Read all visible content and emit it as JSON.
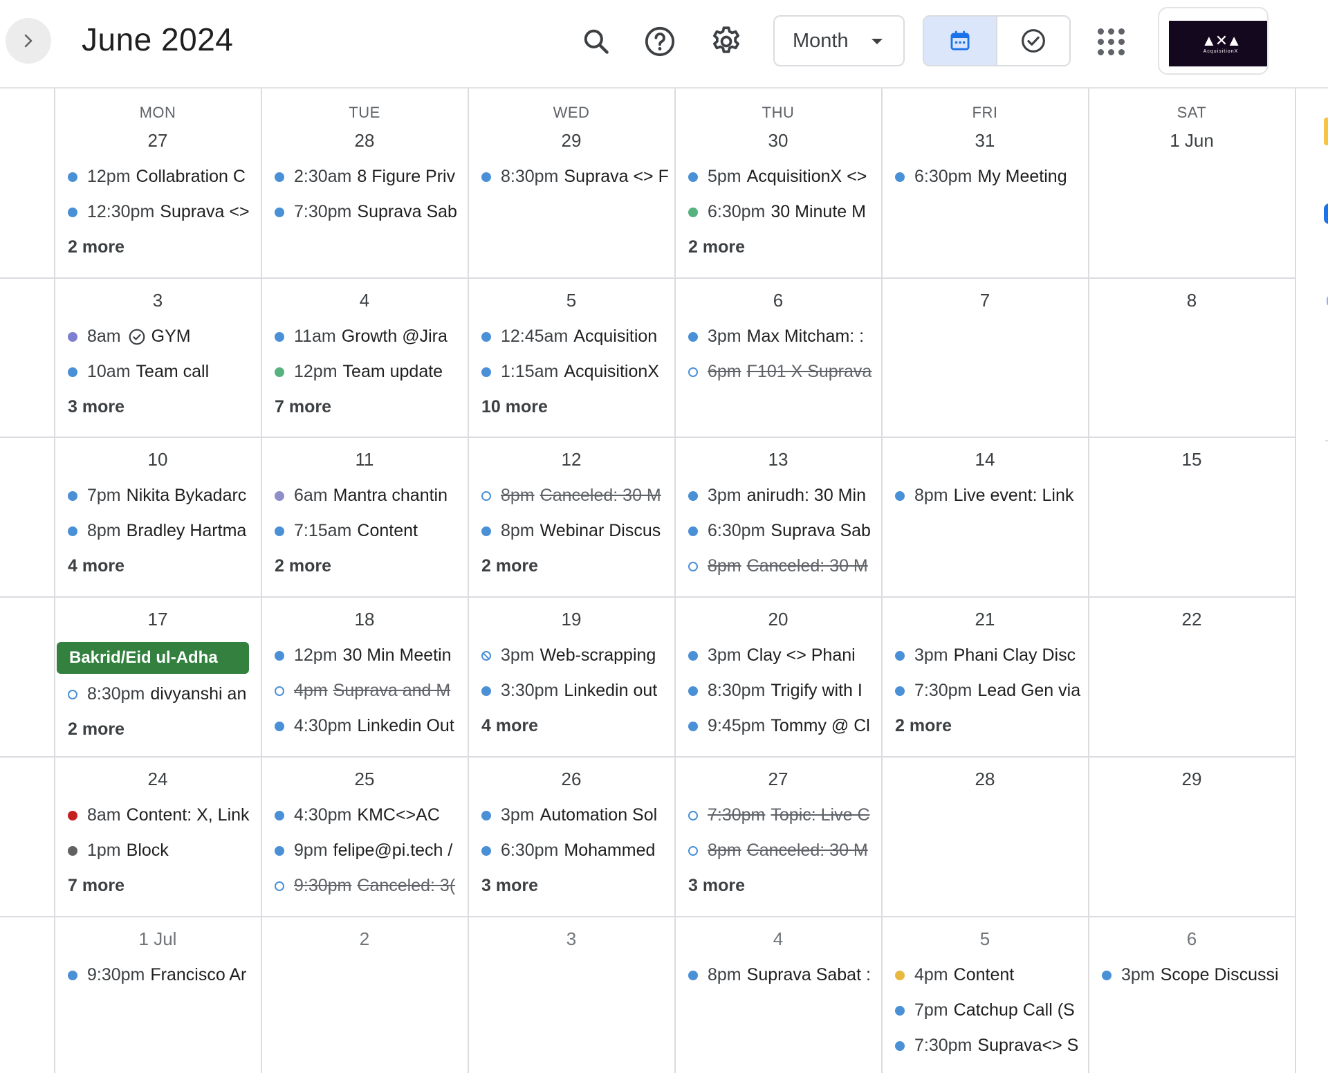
{
  "header": {
    "title": "June 2024",
    "view": "Month",
    "icons": [
      "chevron-right-icon",
      "search-icon",
      "help-icon",
      "settings-icon",
      "calendar-icon",
      "tasks-check-icon",
      "apps-grid-icon"
    ],
    "account_logo_text": "AcquisitionX"
  },
  "colors": {
    "blue": "#4a90d6",
    "green": "#57b27f",
    "purple": "#7f7fd1",
    "lavender": "#8e8ec8",
    "red": "#c5221f",
    "gray": "#616161",
    "yellow": "#e8b93f",
    "holiday": "#33803f",
    "active_view": "#dbe6fb"
  },
  "weekdays": [
    "MON",
    "TUE",
    "WED",
    "THU",
    "FRI",
    "SAT"
  ],
  "weeks": [
    [
      {
        "day": "27",
        "events": [
          {
            "time": "12pm",
            "name": "Collabration C",
            "color": "blue"
          },
          {
            "time": "12:30pm",
            "name": "Suprava <>",
            "color": "blue"
          }
        ],
        "more": "2 more"
      },
      {
        "day": "28",
        "events": [
          {
            "time": "2:30am",
            "name": "8 Figure Priv",
            "color": "blue"
          },
          {
            "time": "7:30pm",
            "name": "Suprava Sab",
            "color": "blue"
          }
        ]
      },
      {
        "day": "29",
        "events": [
          {
            "time": "8:30pm",
            "name": "Suprava <> F",
            "color": "blue"
          }
        ]
      },
      {
        "day": "30",
        "events": [
          {
            "time": "5pm",
            "name": "AcquisitionX <>",
            "color": "blue"
          },
          {
            "time": "6:30pm",
            "name": "30 Minute M",
            "color": "green"
          }
        ],
        "more": "2 more"
      },
      {
        "day": "31",
        "events": [
          {
            "time": "6:30pm",
            "name": "My Meeting",
            "color": "blue"
          }
        ]
      },
      {
        "day": "1 Jun",
        "events": []
      }
    ],
    [
      {
        "day": "3",
        "events": [
          {
            "time": "8am",
            "name": "GYM",
            "color": "purple",
            "task": true
          },
          {
            "time": "10am",
            "name": "Team call",
            "color": "blue"
          }
        ],
        "more": "3 more"
      },
      {
        "day": "4",
        "events": [
          {
            "time": "11am",
            "name": "Growth @Jira",
            "color": "blue"
          },
          {
            "time": "12pm",
            "name": "Team update",
            "color": "green"
          }
        ],
        "more": "7 more"
      },
      {
        "day": "5",
        "events": [
          {
            "time": "12:45am",
            "name": "Acquisition",
            "color": "blue"
          },
          {
            "time": "1:15am",
            "name": "AcquisitionX",
            "color": "blue"
          }
        ],
        "more": "10 more"
      },
      {
        "day": "6",
        "events": [
          {
            "time": "3pm",
            "name": "Max Mitcham: :",
            "color": "blue"
          },
          {
            "time": "6pm",
            "name": "F101 X Suprava",
            "color": "blue",
            "declined": true
          }
        ]
      },
      {
        "day": "7",
        "events": []
      },
      {
        "day": "8",
        "events": []
      }
    ],
    [
      {
        "day": "10",
        "events": [
          {
            "time": "7pm",
            "name": "Nikita Bykadarc",
            "color": "blue"
          },
          {
            "time": "8pm",
            "name": "Bradley Hartma",
            "color": "blue"
          }
        ],
        "more": "4 more"
      },
      {
        "day": "11",
        "events": [
          {
            "time": "6am",
            "name": "Mantra chantin",
            "color": "lavender"
          },
          {
            "time": "7:15am",
            "name": "Content",
            "color": "blue"
          }
        ],
        "more": "2 more"
      },
      {
        "day": "12",
        "events": [
          {
            "time": "8pm",
            "name": "Canceled: 30 M",
            "color": "blue",
            "declined": true
          },
          {
            "time": "8pm",
            "name": "Webinar Discus",
            "color": "blue"
          }
        ],
        "more": "2 more"
      },
      {
        "day": "13",
        "events": [
          {
            "time": "3pm",
            "name": "anirudh: 30 Min",
            "color": "blue"
          },
          {
            "time": "6:30pm",
            "name": "Suprava Sab",
            "color": "blue"
          },
          {
            "time": "8pm",
            "name": "Canceled: 30 M",
            "color": "blue",
            "declined": true
          }
        ]
      },
      {
        "day": "14",
        "events": [
          {
            "time": "8pm",
            "name": "Live event: Link",
            "color": "blue"
          }
        ]
      },
      {
        "day": "15",
        "events": []
      }
    ],
    [
      {
        "day": "17",
        "allday": "Bakrid/Eid ul-Adha",
        "events": [
          {
            "time": "8:30pm",
            "name": "divyanshi an",
            "color": "blue",
            "hollow": true
          }
        ],
        "more": "2 more"
      },
      {
        "day": "18",
        "events": [
          {
            "time": "12pm",
            "name": "30 Min Meetin",
            "color": "blue"
          },
          {
            "time": "4pm",
            "name": "Suprava and M",
            "color": "blue",
            "declined": true
          },
          {
            "time": "4:30pm",
            "name": "Linkedin Out",
            "color": "blue"
          }
        ]
      },
      {
        "day": "19",
        "events": [
          {
            "time": "3pm",
            "name": "Web-scrapping",
            "color": "blue",
            "slashed": true
          },
          {
            "time": "3:30pm",
            "name": "Linkedin out",
            "color": "blue"
          }
        ],
        "more": "4 more"
      },
      {
        "day": "20",
        "events": [
          {
            "time": "3pm",
            "name": "Clay <> Phani",
            "color": "blue"
          },
          {
            "time": "8:30pm",
            "name": "Trigify with I",
            "color": "blue"
          },
          {
            "time": "9:45pm",
            "name": "Tommy @ Cl",
            "color": "blue"
          }
        ]
      },
      {
        "day": "21",
        "events": [
          {
            "time": "3pm",
            "name": "Phani Clay Disc",
            "color": "blue"
          },
          {
            "time": "7:30pm",
            "name": "Lead Gen via",
            "color": "blue"
          }
        ],
        "more": "2 more"
      },
      {
        "day": "22",
        "events": []
      }
    ],
    [
      {
        "day": "24",
        "events": [
          {
            "time": "8am",
            "name": "Content: X, Link",
            "color": "red"
          },
          {
            "time": "1pm",
            "name": "Block",
            "color": "gray"
          }
        ],
        "more": "7 more"
      },
      {
        "day": "25",
        "events": [
          {
            "time": "4:30pm",
            "name": "KMC<>AC",
            "color": "blue"
          },
          {
            "time": "9pm",
            "name": "felipe@pi.tech /",
            "color": "blue"
          },
          {
            "time": "9:30pm",
            "name": "Canceled: 3(",
            "color": "blue",
            "declined": true
          }
        ]
      },
      {
        "day": "26",
        "events": [
          {
            "time": "3pm",
            "name": "Automation Sol",
            "color": "blue"
          },
          {
            "time": "6:30pm",
            "name": "Mohammed",
            "color": "blue"
          }
        ],
        "more": "3 more"
      },
      {
        "day": "27",
        "events": [
          {
            "time": "7:30pm",
            "name": "Topic: Live C",
            "color": "blue",
            "declined": true
          },
          {
            "time": "8pm",
            "name": "Canceled: 30 M",
            "color": "blue",
            "declined": true
          }
        ],
        "more": "3 more"
      },
      {
        "day": "28",
        "events": []
      },
      {
        "day": "29",
        "events": []
      }
    ],
    [
      {
        "day": "1 Jul",
        "muted": true,
        "events": [
          {
            "time": "9:30pm",
            "name": "Francisco Ar",
            "color": "blue"
          }
        ]
      },
      {
        "day": "2",
        "muted": true,
        "events": []
      },
      {
        "day": "3",
        "muted": true,
        "events": []
      },
      {
        "day": "4",
        "muted": true,
        "events": [
          {
            "time": "8pm",
            "name": "Suprava Sabat :",
            "color": "blue"
          }
        ]
      },
      {
        "day": "5",
        "muted": true,
        "events": [
          {
            "time": "4pm",
            "name": "Content",
            "color": "yellow"
          },
          {
            "time": "7pm",
            "name": "Catchup Call (S",
            "color": "blue"
          },
          {
            "time": "7:30pm",
            "name": "Suprava<> S",
            "color": "blue"
          }
        ]
      },
      {
        "day": "6",
        "muted": true,
        "events": [
          {
            "time": "3pm",
            "name": "Scope Discussi",
            "color": "blue"
          }
        ]
      }
    ]
  ]
}
